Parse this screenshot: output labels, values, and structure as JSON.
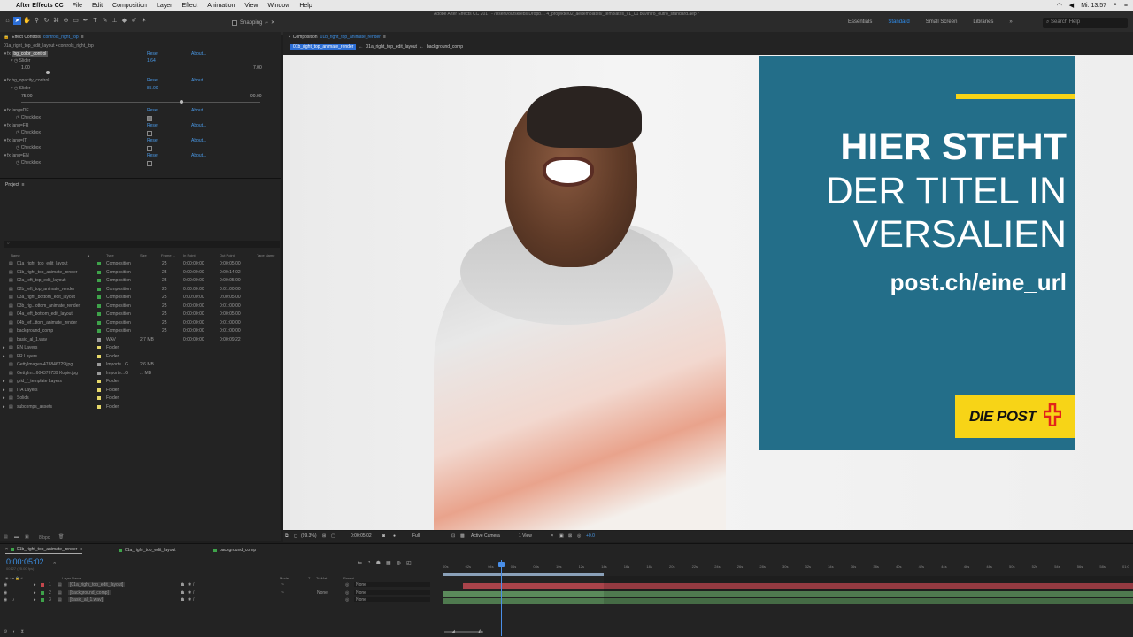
{
  "menubar": {
    "app_name": "After Effects CC",
    "items": [
      "File",
      "Edit",
      "Composition",
      "Layer",
      "Effect",
      "Animation",
      "View",
      "Window",
      "Help"
    ],
    "clock": "Mi. 13:57"
  },
  "window_title": "Adobe After Effects CC 2017 - /Users/ourskrebs/Dropb… 4_projekte/02_ae/templates/_templates_v1_01 bul/intro_outro_standard.aep *",
  "toolbar": {
    "snapping_label": "Snapping",
    "workspaces": [
      "Essentials",
      "Standard",
      "Small Screen",
      "Libraries"
    ],
    "active_workspace": "Standard",
    "help_placeholder": "Search Help"
  },
  "effect_controls": {
    "tab_label": "Effect Controls",
    "tab_target": "controls_right_top",
    "breadcrumb": "01a_right_top_edit_layout • controls_right_top",
    "reset_label": "Reset",
    "about_label": "About...",
    "bg_color": {
      "name": "bg_color_control",
      "slider_label": "Slider",
      "value": "1.64",
      "min": "1.00",
      "max": "7.00",
      "fraction": 0.11
    },
    "bg_opacity": {
      "name": "bg_opacity_control",
      "slider_label": "Slider",
      "value": "85.00",
      "min": "75.00",
      "max": "90.00",
      "fraction": 0.67
    },
    "langs": [
      {
        "name": "lang=DE",
        "checkbox": "Checkbox",
        "checked": true
      },
      {
        "name": "lang=FR",
        "checkbox": "Checkbox",
        "checked": false
      },
      {
        "name": "lang=IT",
        "checkbox": "Checkbox",
        "checked": false
      },
      {
        "name": "lang=EN",
        "checkbox": "Checkbox",
        "checked": false
      }
    ]
  },
  "project": {
    "tab_label": "Project",
    "search_placeholder": "",
    "columns": [
      "Name",
      "Type",
      "Size",
      "Frame ...",
      "In Point",
      "Out Point",
      "Tape Name"
    ],
    "items": [
      {
        "name": "01a_right_top_edit_layout",
        "type": "Composition",
        "size": "",
        "fps": "25",
        "in": "0:00:00:00",
        "out": "0:00:05:00",
        "color": "#3ea34a"
      },
      {
        "name": "01b_right_top_animate_render",
        "type": "Composition",
        "size": "",
        "fps": "25",
        "in": "0:00:00:00",
        "out": "0:00:14:02",
        "color": "#3ea34a"
      },
      {
        "name": "02a_left_top_edit_layout",
        "type": "Composition",
        "size": "",
        "fps": "25",
        "in": "0:00:00:00",
        "out": "0:00:05:00",
        "color": "#3ea34a"
      },
      {
        "name": "02b_left_top_animate_render",
        "type": "Composition",
        "size": "",
        "fps": "25",
        "in": "0:00:00:00",
        "out": "0:01:00:00",
        "color": "#3ea34a"
      },
      {
        "name": "03a_right_bottom_edit_layout",
        "type": "Composition",
        "size": "",
        "fps": "25",
        "in": "0:00:00:00",
        "out": "0:00:05:00",
        "color": "#3ea34a"
      },
      {
        "name": "03b_rig...ottom_animate_render",
        "type": "Composition",
        "size": "",
        "fps": "25",
        "in": "0:00:00:00",
        "out": "0:01:00:00",
        "color": "#3ea34a"
      },
      {
        "name": "04a_left_bottom_edit_layout",
        "type": "Composition",
        "size": "",
        "fps": "25",
        "in": "0:00:00:00",
        "out": "0:00:05:00",
        "color": "#3ea34a"
      },
      {
        "name": "04b_lef...ttom_animate_render",
        "type": "Composition",
        "size": "",
        "fps": "25",
        "in": "0:00:00:00",
        "out": "0:01:00:00",
        "color": "#3ea34a"
      },
      {
        "name": "background_comp",
        "type": "Composition",
        "size": "",
        "fps": "25",
        "in": "0:00:00:00",
        "out": "0:01:00:00",
        "color": "#3ea34a"
      },
      {
        "name": "basic_al_1.wav",
        "type": "WAV",
        "size": "2.7 MB",
        "fps": "",
        "in": "0:00:00:00",
        "out": "0:00:09:22",
        "color": "#9a9a9a"
      },
      {
        "name": "EN Layers",
        "type": "Folder",
        "size": "",
        "fps": "",
        "in": "",
        "out": "",
        "color": "#e6d86a"
      },
      {
        "name": "FR Layers",
        "type": "Folder",
        "size": "",
        "fps": "",
        "in": "",
        "out": "",
        "color": "#e6d86a"
      },
      {
        "name": "GettyImages-476846729.jpg",
        "type": "Importe...G",
        "size": "2.6 MB",
        "fps": "",
        "in": "",
        "out": "",
        "color": "#9a9a9a"
      },
      {
        "name": "GettyIm...604376739 Kopie.jpg",
        "type": "Importe...G",
        "size": "... MB",
        "fps": "",
        "in": "",
        "out": "",
        "color": "#9a9a9a"
      },
      {
        "name": "grid_f_template Layers",
        "type": "Folder",
        "size": "",
        "fps": "",
        "in": "",
        "out": "",
        "color": "#e6d86a"
      },
      {
        "name": "ITA Layers",
        "type": "Folder",
        "size": "",
        "fps": "",
        "in": "",
        "out": "",
        "color": "#e6d86a"
      },
      {
        "name": "Solids",
        "type": "Folder",
        "size": "",
        "fps": "",
        "in": "",
        "out": "",
        "color": "#e6d86a"
      },
      {
        "name": "subcomps_assets",
        "type": "Folder",
        "size": "",
        "fps": "",
        "in": "",
        "out": "",
        "color": "#e6d86a"
      }
    ],
    "bpc": "8 bpc"
  },
  "composition": {
    "tab_label": "Composition",
    "tab_target": "01b_right_top_animate_render",
    "breadcrumbs": [
      "01b_right_top_animate_render",
      "01a_right_top_edit_layout",
      "background_comp"
    ],
    "banner": {
      "line1": "HIER STEHT",
      "line2": "DER TITEL IN",
      "line3": "VERSALIEN",
      "url": "post.ch/eine_url",
      "logo": "DIE POST",
      "bg": "#236e89",
      "accent": "#f7d417"
    },
    "viewer_bar": {
      "zoom": "(99.3%)",
      "time": "0:00:05:02",
      "resolution": "Full",
      "camera": "Active Camera",
      "view": "1 View",
      "exposure": "+0.0"
    }
  },
  "timeline": {
    "tabs": [
      {
        "label": "01b_right_top_animate_render",
        "active": true
      },
      {
        "label": "01a_right_top_edit_layout",
        "active": false
      },
      {
        "label": "background_comp",
        "active": false
      }
    ],
    "timecode": "0:00:05:02",
    "fps_text": "00127 (25.00 fps)",
    "columns": [
      "Layer Name",
      "Mode",
      "T",
      "TrkMat",
      "Parent"
    ],
    "layers": [
      {
        "num": "1",
        "name": "[01a_right_top_edit_layout]",
        "mode": "~",
        "trkmat": "",
        "parent": "None",
        "color": "#c4474c",
        "start": 0.03,
        "end": 1.0
      },
      {
        "num": "2",
        "name": "[background_comp]",
        "mode": "~",
        "trkmat": "None",
        "parent": "None",
        "color": "#3ea34a",
        "start": 0.0,
        "end": 1.0
      },
      {
        "num": "3",
        "name": "[basic_al_1.wav]",
        "mode": "",
        "trkmat": "",
        "parent": "None",
        "color": "#3ea34a",
        "start": 0.0,
        "end": 1.0
      }
    ],
    "ruler": [
      "00s",
      "02s",
      "04s",
      "06s",
      "08s",
      "10s",
      "12s",
      "14s",
      "16s",
      "18s",
      "20s",
      "22s",
      "24s",
      "26s",
      "28s",
      "30s",
      "32s",
      "34s",
      "36s",
      "38s",
      "40s",
      "42s",
      "44s",
      "46s",
      "48s",
      "50s",
      "52s",
      "54s",
      "56s",
      "58s",
      "01:0"
    ],
    "playhead_fraction": 0.085
  }
}
